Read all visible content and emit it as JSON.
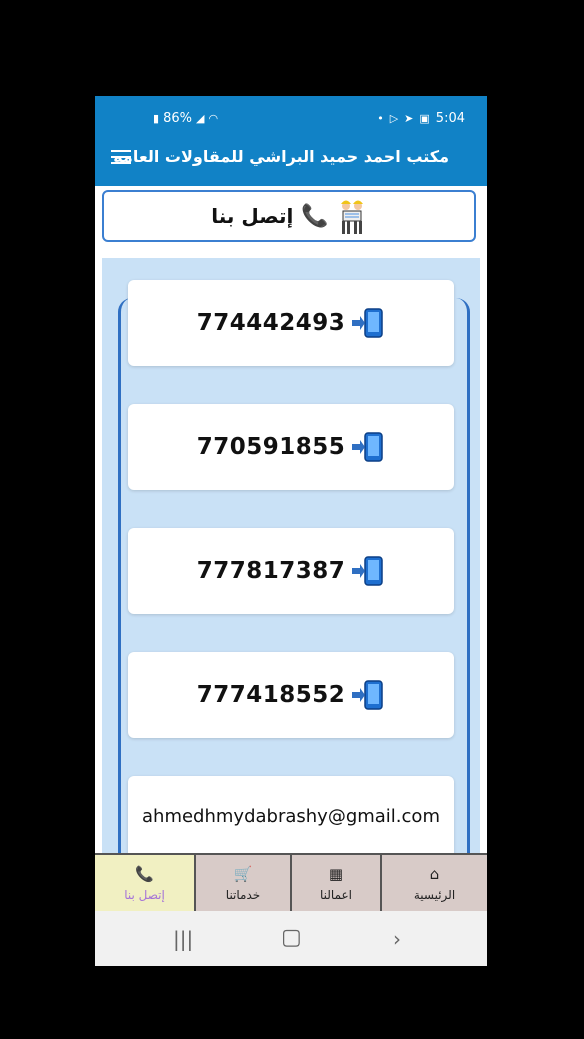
{
  "status_bar": {
    "battery": "86%",
    "time": "5:04"
  },
  "app_bar": {
    "title": "مكتب احمد حميد البراشي للمقاولات العامه",
    "menu_icon": "hamburger-menu-icon"
  },
  "header": {
    "title": "إتصل بنا",
    "icons": [
      "phone-icon",
      "workers-icon"
    ]
  },
  "contacts": [
    {
      "type": "phone",
      "value": "774442493",
      "icon": "mobile-incoming-icon"
    },
    {
      "type": "phone",
      "value": "770591855",
      "icon": "mobile-incoming-icon"
    },
    {
      "type": "phone",
      "value": "777817387",
      "icon": "mobile-incoming-icon"
    },
    {
      "type": "phone",
      "value": "777418552",
      "icon": "mobile-incoming-icon"
    },
    {
      "type": "email",
      "value": "ahmedhmydabrashy@gmail.com"
    }
  ],
  "bottom_nav": [
    {
      "label": "إتصل بنا",
      "icon": "phone-icon",
      "active": true
    },
    {
      "label": "خدماتنا",
      "icon": "cart-icon",
      "active": false
    },
    {
      "label": "اعمالنا",
      "icon": "store-icon",
      "active": false
    },
    {
      "label": "الرئيسية",
      "icon": "home-icon",
      "active": false
    }
  ],
  "colors": {
    "primary": "#1182c6",
    "content_bg": "#c9e1f6",
    "nav_bg": "#d8cbc8",
    "nav_active_bg": "#f1f0c2",
    "nav_active_text": "#a674d8"
  }
}
